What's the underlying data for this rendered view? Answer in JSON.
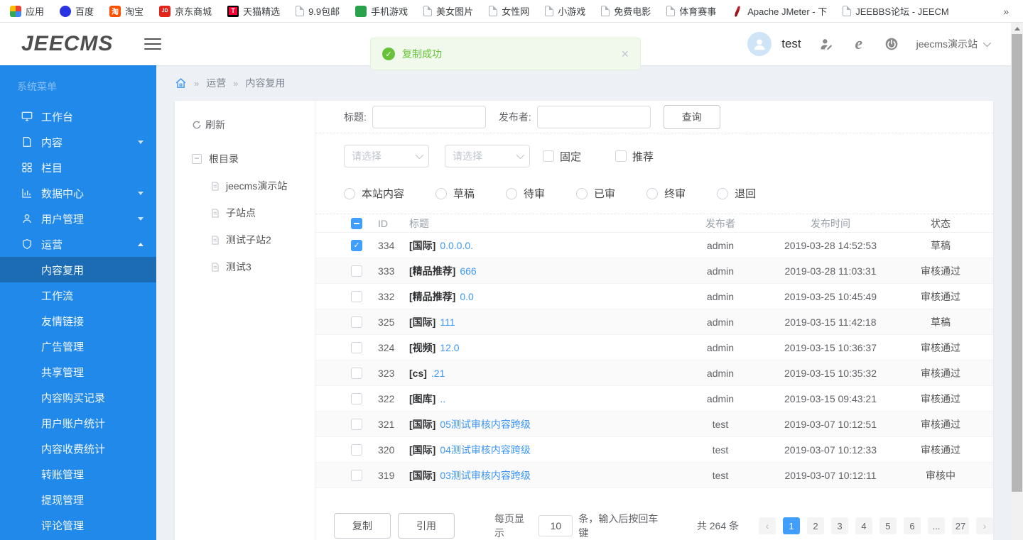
{
  "bookmarks": {
    "items": [
      {
        "label": "应用",
        "icon": "apps"
      },
      {
        "label": "百度",
        "icon": "baidu"
      },
      {
        "label": "淘宝",
        "icon": "taobao",
        "icon_text": "淘"
      },
      {
        "label": "京东商城",
        "icon": "jd",
        "icon_text": "JD"
      },
      {
        "label": "天猫精选",
        "icon": "tmall",
        "icon_text": "T"
      },
      {
        "label": "9.9包邮",
        "icon": "page"
      },
      {
        "label": "手机游戏",
        "icon": "game"
      },
      {
        "label": "美女图片",
        "icon": "page"
      },
      {
        "label": "女性网",
        "icon": "page"
      },
      {
        "label": "小游戏",
        "icon": "page"
      },
      {
        "label": "免费电影",
        "icon": "page"
      },
      {
        "label": "体育赛事",
        "icon": "page"
      },
      {
        "label": "Apache JMeter - 下",
        "icon": "jmeter"
      },
      {
        "label": "JEEBBS论坛 - JEECM",
        "icon": "page"
      }
    ],
    "overflow": "»"
  },
  "header": {
    "logo": "JEECMS",
    "username": "test",
    "site": "jeecms演示站"
  },
  "toast": {
    "message": "复制成功",
    "close": "×"
  },
  "sidebar": {
    "section": "系统菜单",
    "items": [
      {
        "label": "工作台"
      },
      {
        "label": "内容"
      },
      {
        "label": "栏目"
      },
      {
        "label": "数据中心"
      },
      {
        "label": "用户管理"
      },
      {
        "label": "运营"
      }
    ],
    "submenu": [
      {
        "label": "内容复用",
        "active": true
      },
      {
        "label": "工作流"
      },
      {
        "label": "友情链接"
      },
      {
        "label": "广告管理"
      },
      {
        "label": "共享管理"
      },
      {
        "label": "内容购买记录"
      },
      {
        "label": "用户账户统计"
      },
      {
        "label": "内容收费统计"
      },
      {
        "label": "转账管理"
      },
      {
        "label": "提现管理"
      },
      {
        "label": "评论管理"
      }
    ]
  },
  "breadcrumb": {
    "sep": "»",
    "items": [
      "运营",
      "内容复用"
    ]
  },
  "tree": {
    "refresh": "刷新",
    "root": "根目录",
    "root_toggle": "−",
    "nodes": [
      {
        "label": "jeecms演示站"
      },
      {
        "label": "子站点"
      },
      {
        "label": "测试子站2"
      },
      {
        "label": "测试3"
      }
    ]
  },
  "search": {
    "title_label": "标题:",
    "publisher_label": "发布者:",
    "button": "查询",
    "select_placeholder": "请选择",
    "checkbox_fixed": "固定",
    "checkbox_recommend": "推荐",
    "radios": [
      {
        "label": "本站内容"
      },
      {
        "label": "草稿"
      },
      {
        "label": "待审"
      },
      {
        "label": "已审"
      },
      {
        "label": "终审"
      },
      {
        "label": "退回"
      }
    ]
  },
  "table": {
    "columns": {
      "id": "ID",
      "title": "标题",
      "publisher": "发布者",
      "time": "发布时间",
      "status": "状态"
    },
    "rows": [
      {
        "checked": true,
        "id": "334",
        "prefix": "[国际]",
        "title": "0.0.0.0.",
        "publisher": "admin",
        "time": "2019-03-28 14:52:53",
        "status": "草稿"
      },
      {
        "id": "333",
        "prefix": "[精品推荐]",
        "title": "666",
        "publisher": "admin",
        "time": "2019-03-28 11:03:31",
        "status": "审核通过"
      },
      {
        "id": "332",
        "prefix": "[精品推荐]",
        "title": "0.0",
        "publisher": "admin",
        "time": "2019-03-25 10:45:49",
        "status": "审核通过"
      },
      {
        "id": "325",
        "prefix": "[国际]",
        "title": "111",
        "publisher": "admin",
        "time": "2019-03-15 11:42:18",
        "status": "草稿"
      },
      {
        "id": "324",
        "prefix": "[视频]",
        "title": "12.0",
        "publisher": "admin",
        "time": "2019-03-15 10:36:37",
        "status": "审核通过"
      },
      {
        "id": "323",
        "prefix": "[cs]",
        "title": ".21",
        "publisher": "admin",
        "time": "2019-03-15 10:35:32",
        "status": "审核通过"
      },
      {
        "id": "322",
        "prefix": "[图库]",
        "title": "..",
        "publisher": "admin",
        "time": "2019-03-15 09:43:21",
        "status": "审核通过"
      },
      {
        "id": "321",
        "prefix": "[国际]",
        "title": "05测试审核内容跨级",
        "publisher": "test",
        "time": "2019-03-07 10:12:51",
        "status": "审核通过"
      },
      {
        "id": "320",
        "prefix": "[国际]",
        "title": "04测试审核内容跨级",
        "publisher": "test",
        "time": "2019-03-07 10:12:33",
        "status": "审核通过"
      },
      {
        "id": "319",
        "prefix": "[国际]",
        "title": "03测试审核内容跨级",
        "publisher": "test",
        "time": "2019-03-07 10:12:11",
        "status": "审核中"
      }
    ]
  },
  "footer": {
    "copy_button": "复制",
    "quote_button": "引用",
    "per_page_label": "每页显示",
    "per_page_value": "10",
    "per_page_suffix": "条，输入后按回车键",
    "total": "共 264 条",
    "prev": "‹",
    "next": "›",
    "pages": [
      {
        "label": "1",
        "active": true
      },
      {
        "label": "2"
      },
      {
        "label": "3"
      },
      {
        "label": "4"
      },
      {
        "label": "5"
      },
      {
        "label": "6"
      },
      {
        "label": "..."
      },
      {
        "label": "27"
      }
    ]
  },
  "colors": {
    "sidebar_blue": "#2189ea",
    "sidebar_active": "#1b6cb5",
    "link_blue": "#3e97f5",
    "checkbox_blue": "#409eff",
    "toast_green": "#67c23a"
  }
}
